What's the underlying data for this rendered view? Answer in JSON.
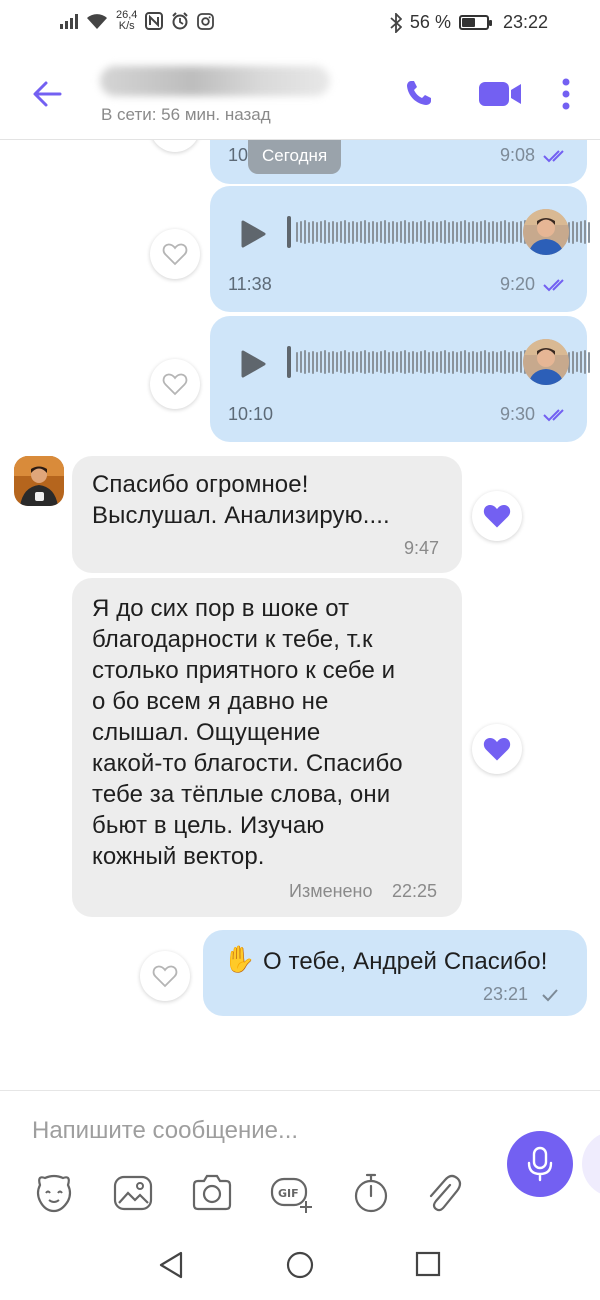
{
  "status_bar": {
    "net_speed_value": "26,4",
    "net_speed_unit": "K/s",
    "battery_percent_text": "56 %",
    "battery_level": 0.56,
    "clock": "23:22"
  },
  "header": {
    "contact_status": "В сети: 56 мин. назад"
  },
  "chat": {
    "date_separator": "Сегодня",
    "partial_message": {
      "duration_partial": "10:1",
      "time": "9:08"
    },
    "voice_messages": [
      {
        "duration": "11:38",
        "time": "9:20"
      },
      {
        "duration": "10:10",
        "time": "9:30"
      }
    ],
    "incoming": [
      {
        "lines": [
          "Спасибо огромное!",
          "Выслушал. Анализирую...."
        ],
        "time": "9:47"
      },
      {
        "lines": [
          "Я до сих пор в шоке от",
          "благодарности к тебе, т.к",
          "столько приятного к себе и",
          "о бо всем я давно не",
          "слышал. Ощущение",
          "какой-то благости. Спасибо",
          "тебе за тёплые слова, они",
          "бьют в цель. Изучаю",
          "кожный вектор."
        ],
        "edited_label": "Изменено",
        "time": "22:25"
      }
    ],
    "outgoing_text": {
      "emoji": "✋",
      "text": "О тебе, Андрей Спасибо!",
      "time": "23:21"
    }
  },
  "composer": {
    "placeholder": "Напишите сообщение..."
  },
  "colors": {
    "accent": "#7360f2",
    "outgoing_bubble": "#cfe5f9",
    "incoming_bubble": "#ededed",
    "read_check": "#7360f2",
    "liked_heart": "#7360f2"
  },
  "icons": [
    "back-arrow-icon",
    "phone-icon",
    "video-camera-icon",
    "more-vert-icon",
    "play-icon",
    "heart-outline-icon",
    "heart-filled-icon",
    "double-check-icon",
    "check-icon",
    "sticker-icon",
    "gallery-icon",
    "camera-icon",
    "gif-icon",
    "timer-icon",
    "paperclip-icon",
    "microphone-icon",
    "nav-back-icon",
    "nav-home-icon",
    "nav-recents-icon"
  ]
}
